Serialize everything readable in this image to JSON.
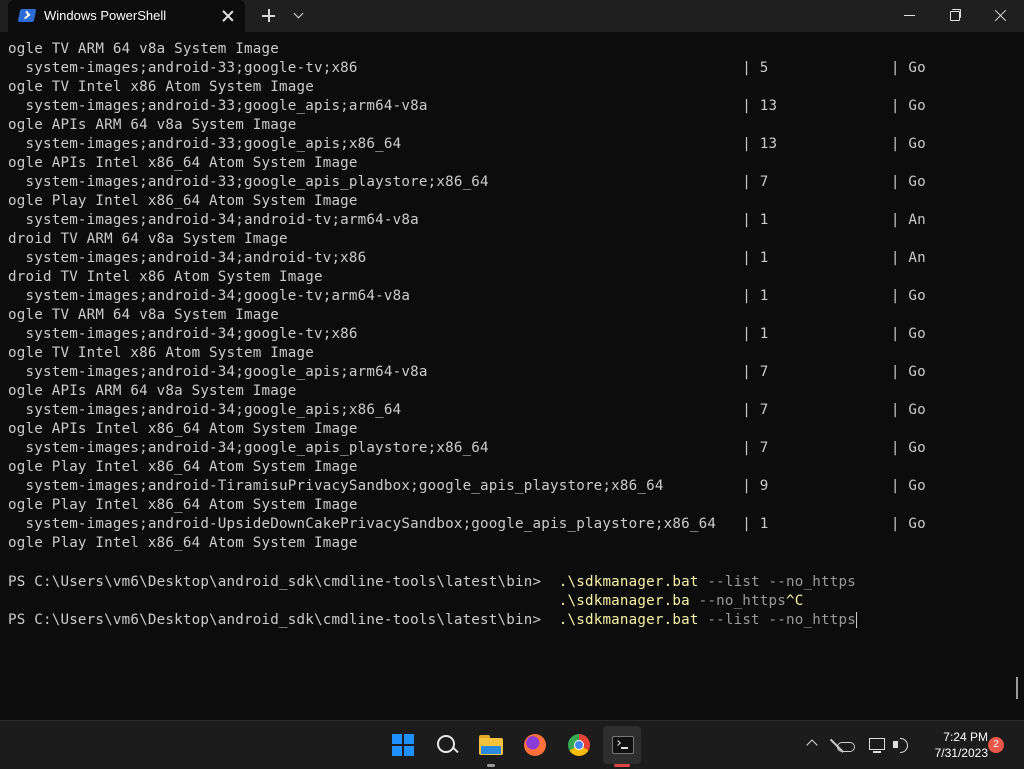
{
  "window": {
    "tab_title": "Windows PowerShell"
  },
  "terminal": {
    "lines": [
      "ogle TV ARM 64 v8a System Image",
      "  system-images;android-33;google-tv;x86                                            | 5              | Go",
      "ogle TV Intel x86 Atom System Image",
      "  system-images;android-33;google_apis;arm64-v8a                                    | 13             | Go",
      "ogle APIs ARM 64 v8a System Image",
      "  system-images;android-33;google_apis;x86_64                                       | 13             | Go",
      "ogle APIs Intel x86_64 Atom System Image",
      "  system-images;android-33;google_apis_playstore;x86_64                             | 7              | Go",
      "ogle Play Intel x86_64 Atom System Image",
      "  system-images;android-34;android-tv;arm64-v8a                                     | 1              | An",
      "droid TV ARM 64 v8a System Image",
      "  system-images;android-34;android-tv;x86                                           | 1              | An",
      "droid TV Intel x86 Atom System Image",
      "  system-images;android-34;google-tv;arm64-v8a                                      | 1              | Go",
      "ogle TV ARM 64 v8a System Image",
      "  system-images;android-34;google-tv;x86                                            | 1              | Go",
      "ogle TV Intel x86 Atom System Image",
      "  system-images;android-34;google_apis;arm64-v8a                                    | 7              | Go",
      "ogle APIs ARM 64 v8a System Image",
      "  system-images;android-34;google_apis;x86_64                                       | 7              | Go",
      "ogle APIs Intel x86_64 Atom System Image",
      "  system-images;android-34;google_apis_playstore;x86_64                             | 7              | Go",
      "ogle Play Intel x86_64 Atom System Image",
      "  system-images;android-TiramisuPrivacySandbox;google_apis_playstore;x86_64         | 9              | Go",
      "ogle Play Intel x86_64 Atom System Image",
      "  system-images;android-UpsideDownCakePrivacySandbox;google_apis_playstore;x86_64   | 1              | Go",
      "ogle Play Intel x86_64 Atom System Image",
      ""
    ],
    "prompt": "PS C:\\Users\\vm6\\Desktop\\android_sdk\\cmdline-tools\\latest\\bin>",
    "prompt_gap": "  ",
    "continuation_indent": "                                                               ",
    "command_1": ".\\sdkmanager.bat",
    "args_1": " --list --no_https",
    "command_2": ".\\sdkmanager.ba",
    "args_2": " --no_https",
    "ctrl_c": "^C",
    "command_3": ".\\sdkmanager.bat",
    "args_3": " --list --no_https"
  },
  "taskbar": {
    "pinned_apps": [
      "start-icon",
      "search-icon",
      "file-explorer-icon",
      "firefox-icon",
      "chrome-icon",
      "terminal-icon"
    ],
    "tray_icons": [
      "chevron-up-icon",
      "onedrive-icon",
      "network-icon",
      "volume-icon"
    ],
    "time": "7:24 PM",
    "date": "7/31/2023",
    "notification_count": "2"
  }
}
